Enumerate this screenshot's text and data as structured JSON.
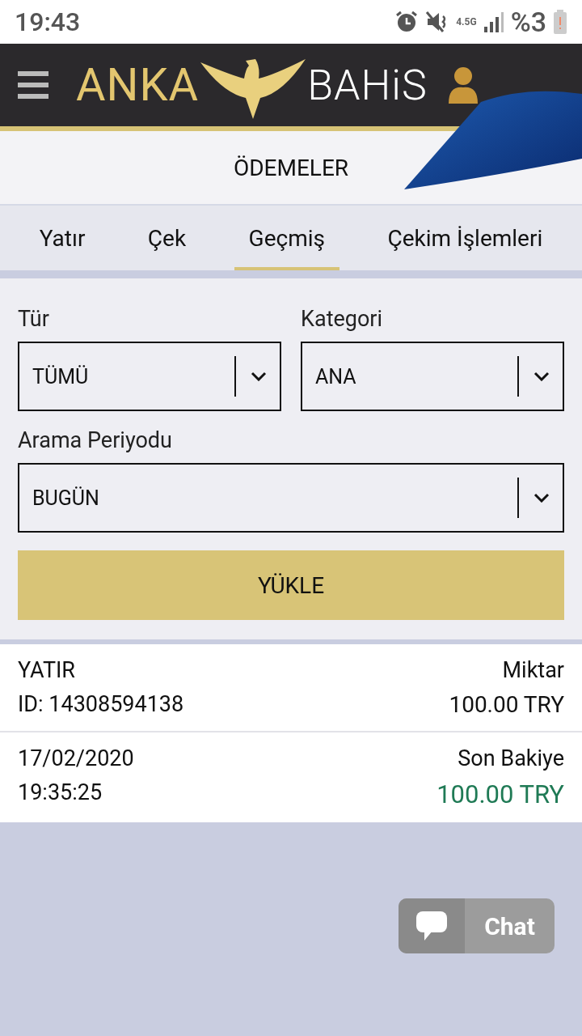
{
  "status_bar": {
    "time": "19:43",
    "network": "4.5G",
    "battery": "%3"
  },
  "header": {
    "logo_left": "ANKA",
    "logo_right": "BAHiS"
  },
  "page_title": "ÖDEMELER",
  "tabs": [
    {
      "label": "Yatır",
      "selected": false
    },
    {
      "label": "Çek",
      "selected": false
    },
    {
      "label": "Geçmiş",
      "selected": true
    },
    {
      "label": "Çekim İşlemleri",
      "selected": false
    }
  ],
  "filters": [
    {
      "label": "Tür",
      "value": "TÜMÜ",
      "wide": false
    },
    {
      "label": "Kategori",
      "value": "ANA",
      "wide": false
    },
    {
      "label": "Arama Periyodu",
      "value": "BUGÜN",
      "wide": true
    }
  ],
  "load_button": "YÜKLE",
  "transaction": {
    "type": "YATIR",
    "id": "ID: 14308594138",
    "amount_label": "Miktar",
    "amount": "100.00 TRY",
    "date": "17/02/2020",
    "time": "19:35:25",
    "balance_label": "Son Bakiye",
    "balance": "100.00 TRY"
  },
  "chat_button": "Chat"
}
